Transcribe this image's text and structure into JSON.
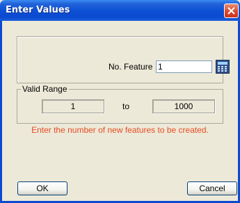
{
  "window": {
    "title": "Enter Values"
  },
  "feature": {
    "label": "No.  Feature",
    "value": "1"
  },
  "range": {
    "legend": "Valid Range",
    "from": "1",
    "separator": "to",
    "to": "1000"
  },
  "hint": "Enter the number of new features to be created.",
  "buttons": {
    "ok": "OK",
    "cancel": "Cancel"
  },
  "colors": {
    "title_bar": "#0a4ad0",
    "hint_text": "#e84b24",
    "dialog_bg": "#ece9d8"
  },
  "icons": {
    "close": "close-icon",
    "calculator": "calculator-icon"
  }
}
